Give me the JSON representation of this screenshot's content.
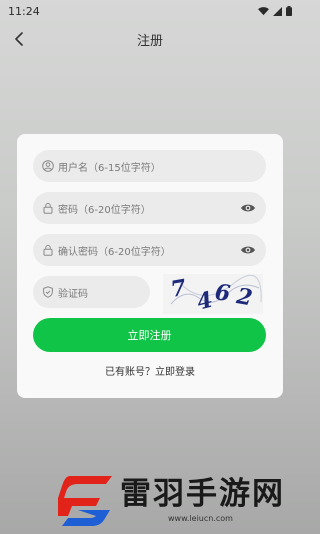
{
  "status_bar": {
    "time": "11:24"
  },
  "header": {
    "title": "注册"
  },
  "form": {
    "username_placeholder": "用户名（6-15位字符）",
    "password_placeholder": "密码（6-20位字符）",
    "confirm_placeholder": "确认密码（6-20位字符）",
    "captcha_placeholder": "验证码",
    "captcha_code": "7462",
    "submit_label": "立即注册",
    "login_prompt": "已有账号？立即登录"
  },
  "watermark": {
    "name": "雷羽手游网",
    "url": "www.leiucn.com"
  },
  "colors": {
    "accent": "#10c448",
    "card": "#f9f9f9",
    "field": "#ebebeb"
  }
}
